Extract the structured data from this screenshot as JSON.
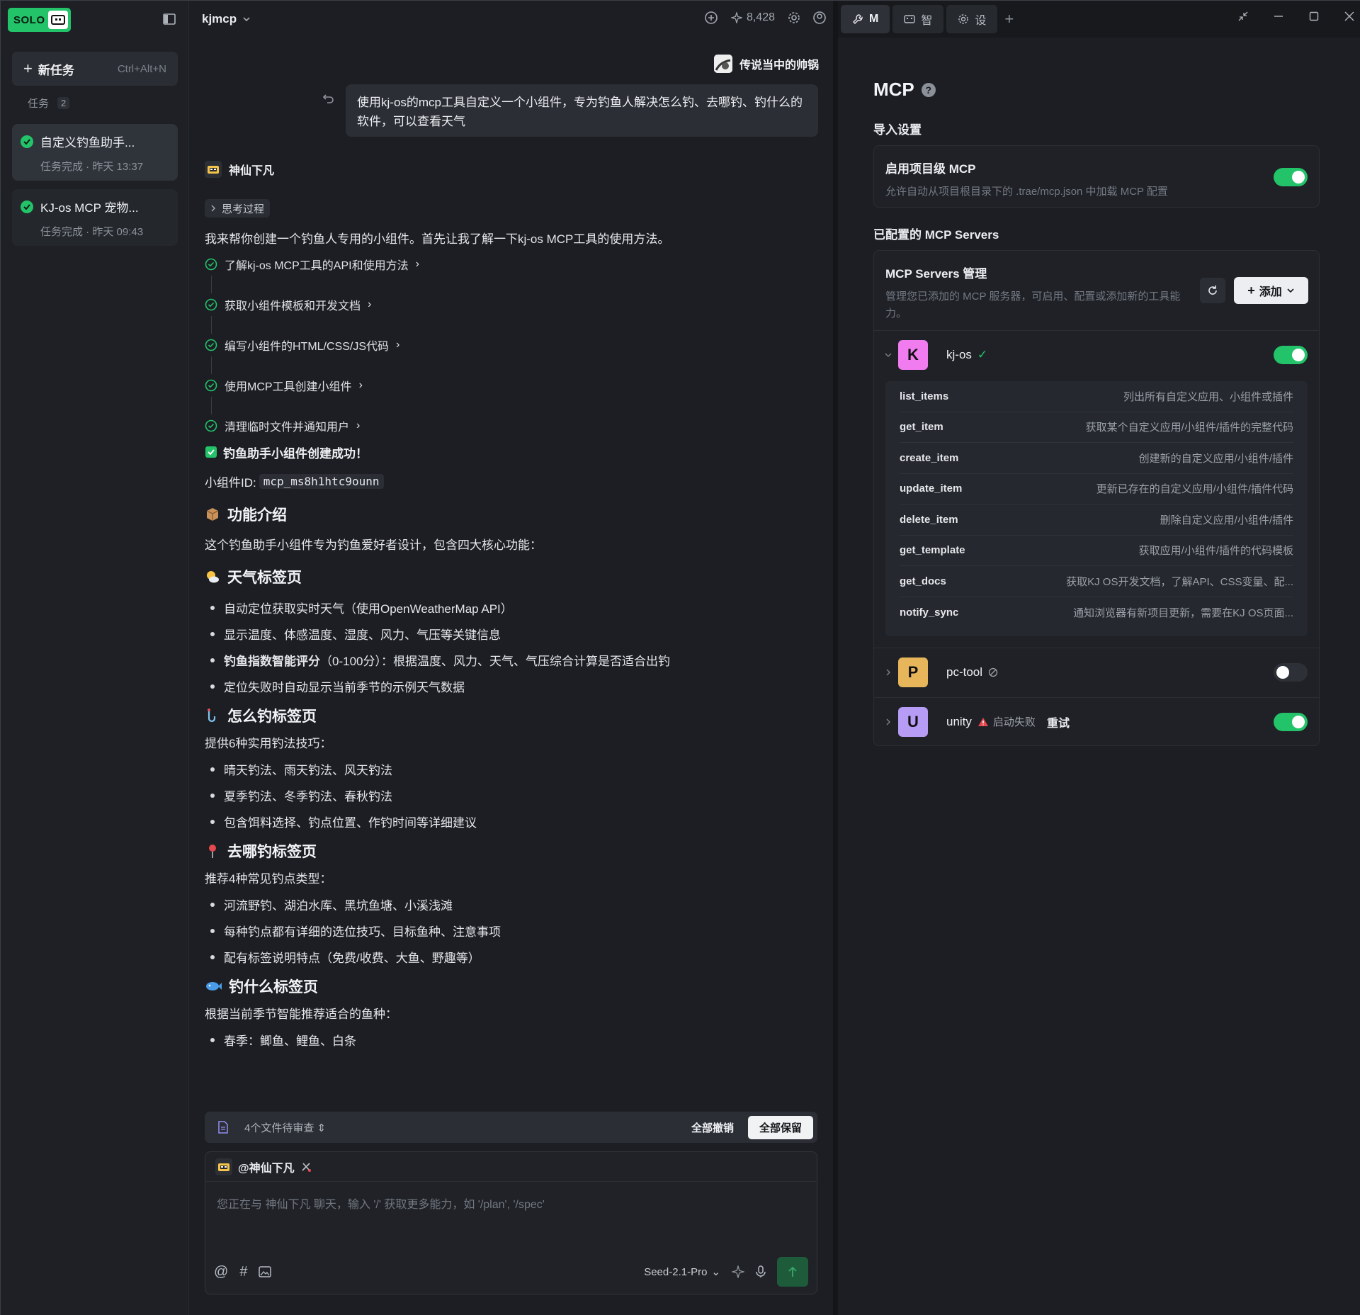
{
  "sidebar": {
    "logo": "SOLO",
    "new_task": {
      "label": "新任务",
      "shortcut": "Ctrl+Alt+N"
    },
    "tasks_header": {
      "label": "任务",
      "count": "2"
    },
    "tasks": [
      {
        "title": "自定义钓鱼助手...",
        "status": "任务完成 · 昨天 13:37"
      },
      {
        "title": "KJ-os MCP 宠物...",
        "status": "任务完成 · 昨天 09:43"
      }
    ]
  },
  "chat": {
    "project": "kjmcp",
    "credits": "8,428",
    "user": {
      "name": "传说当中的帅锅",
      "message": "使用kj-os的mcp工具自定义一个小组件，专为钓鱼人解决怎么钓、去哪钓、钓什么的软件，可以查看天气"
    },
    "bot": {
      "name": "神仙下凡",
      "thinking_label": "思考过程",
      "intro": "我来帮你创建一个钓鱼人专用的小组件。首先让我了解一下kj-os MCP工具的使用方法。",
      "steps": [
        "了解kj-os MCP工具的API和使用方法",
        "获取小组件模板和开发文档",
        "编写小组件的HTML/CSS/JS代码",
        "使用MCP工具创建小组件",
        "清理临时文件并通知用户"
      ],
      "success": "钓鱼助手小组件创建成功！",
      "widget_id_label": "小组件ID:",
      "widget_id": "mcp_ms8h1htc9ounn",
      "features_title": "功能介绍",
      "features_intro": "这个钓鱼助手小组件专为钓鱼爱好者设计，包含四大核心功能：",
      "weather": {
        "title": "天气标签页",
        "items": [
          "自动定位获取实时天气（使用OpenWeatherMap API）",
          "显示温度、体感温度、湿度、风力、气压等关键信息",
          "（0-100分）：根据温度、风力、天气、气压综合计算是否适合出钓",
          "定位失败时自动显示当前季节的示例天气数据"
        ],
        "bold_prefix": "钓鱼指数智能评分"
      },
      "how": {
        "title": "怎么钓标签页",
        "intro": "提供6种实用钓法技巧：",
        "items": [
          "晴天钓法、雨天钓法、风天钓法",
          "夏季钓法、冬季钓法、春秋钓法",
          "包含饵料选择、钓点位置、作钓时间等详细建议"
        ]
      },
      "where": {
        "title": "去哪钓标签页",
        "intro": "推荐4种常见钓点类型：",
        "items": [
          "河流野钓、湖泊水库、黑坑鱼塘、小溪浅滩",
          "每种钓点都有详细的选位技巧、目标鱼种、注意事项",
          "配有标签说明特点（免费/收费、大鱼、野趣等）"
        ]
      },
      "what": {
        "title": "钓什么标签页",
        "intro": "根据当前季节智能推荐适合的鱼种：",
        "items": [
          "春季：鲫鱼、鲤鱼、白条"
        ]
      }
    },
    "review": {
      "label": "4个文件待审查",
      "revert_all": "全部撤销",
      "keep_all": "全部保留"
    },
    "input": {
      "mention": "@神仙下凡",
      "placeholder": "您正在与 神仙下凡 聊天，输入 '/' 获取更多能力，如 '/plan', '/spec'",
      "model": "Seed-2.1-Pro"
    }
  },
  "panel": {
    "tabs": [
      {
        "label": "M",
        "icon": "wrench-icon"
      },
      {
        "label": "智",
        "icon": "robot-icon"
      },
      {
        "label": "设",
        "icon": "gear-icon"
      }
    ],
    "title": "MCP",
    "import_section": "导入设置",
    "project_mcp": {
      "title": "启用项目级 MCP",
      "desc": "允许自动从项目根目录下的 .trae/mcp.json 中加载 MCP 配置",
      "enabled": true
    },
    "configured_section": "已配置的 MCP Servers",
    "manage": {
      "title": "MCP Servers 管理",
      "desc": "管理您已添加的 MCP 服务器，可启用、配置或添加新的工具能力。",
      "add": "添加"
    },
    "servers": [
      {
        "letter": "K",
        "name": "kj-os",
        "color": "#f07cf0",
        "enabled": true,
        "state": "ok"
      },
      {
        "letter": "P",
        "name": "pc-tool",
        "color": "#e7b65a",
        "enabled": false,
        "state": "disabled"
      },
      {
        "letter": "U",
        "name": "unity",
        "color": "#b79cf5",
        "enabled": true,
        "state": "failed",
        "status": "启动失败",
        "retry": "重试"
      }
    ],
    "tools": [
      {
        "name": "list_items",
        "desc": "列出所有自定义应用、小组件或插件"
      },
      {
        "name": "get_item",
        "desc": "获取某个自定义应用/小组件/插件的完整代码"
      },
      {
        "name": "create_item",
        "desc": "创建新的自定义应用/小组件/插件"
      },
      {
        "name": "update_item",
        "desc": "更新已存在的自定义应用/小组件/插件代码"
      },
      {
        "name": "delete_item",
        "desc": "删除自定义应用/小组件/插件"
      },
      {
        "name": "get_template",
        "desc": "获取应用/小组件/插件的代码模板"
      },
      {
        "name": "get_docs",
        "desc": "获取KJ OS开发文档，了解API、CSS变量、配..."
      },
      {
        "name": "notify_sync",
        "desc": "通知浏览器有新项目更新，需要在KJ OS页面..."
      }
    ]
  }
}
